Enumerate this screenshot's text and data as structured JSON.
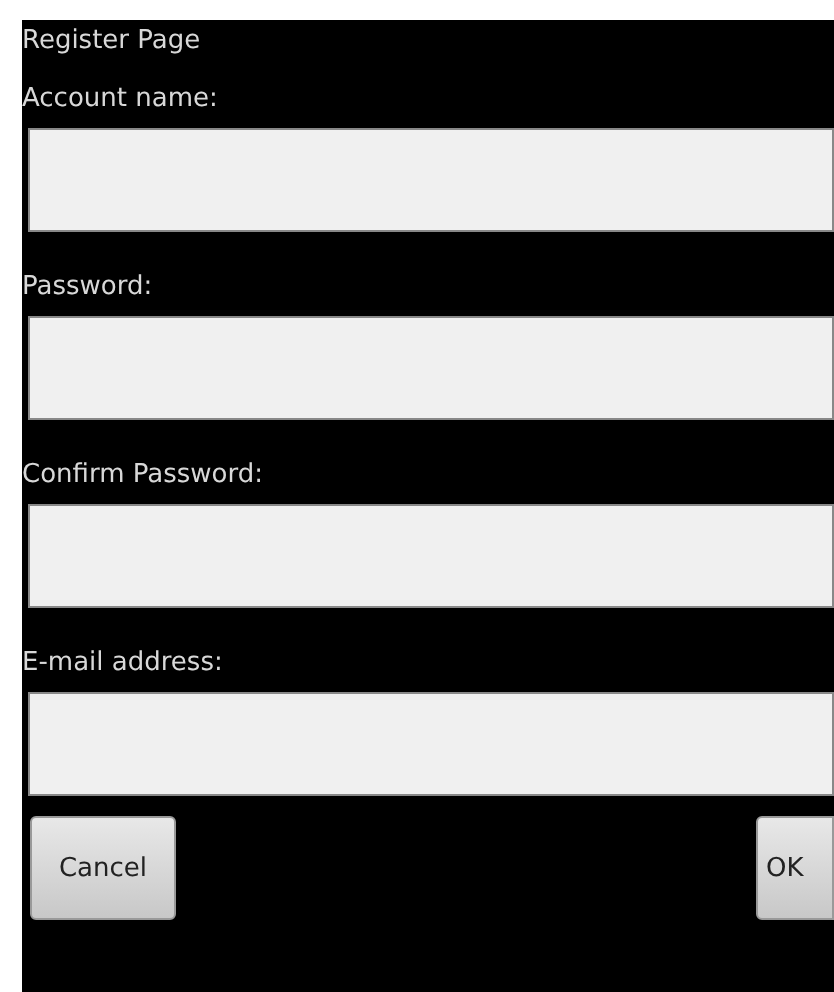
{
  "window": {
    "title": "Register Page"
  },
  "fields": [
    {
      "label": "Account name:"
    },
    {
      "label": "Password:"
    },
    {
      "label": "Confirm Password:"
    },
    {
      "label": "E-mail address:"
    }
  ],
  "buttons": [
    "Cancel",
    "OK"
  ]
}
